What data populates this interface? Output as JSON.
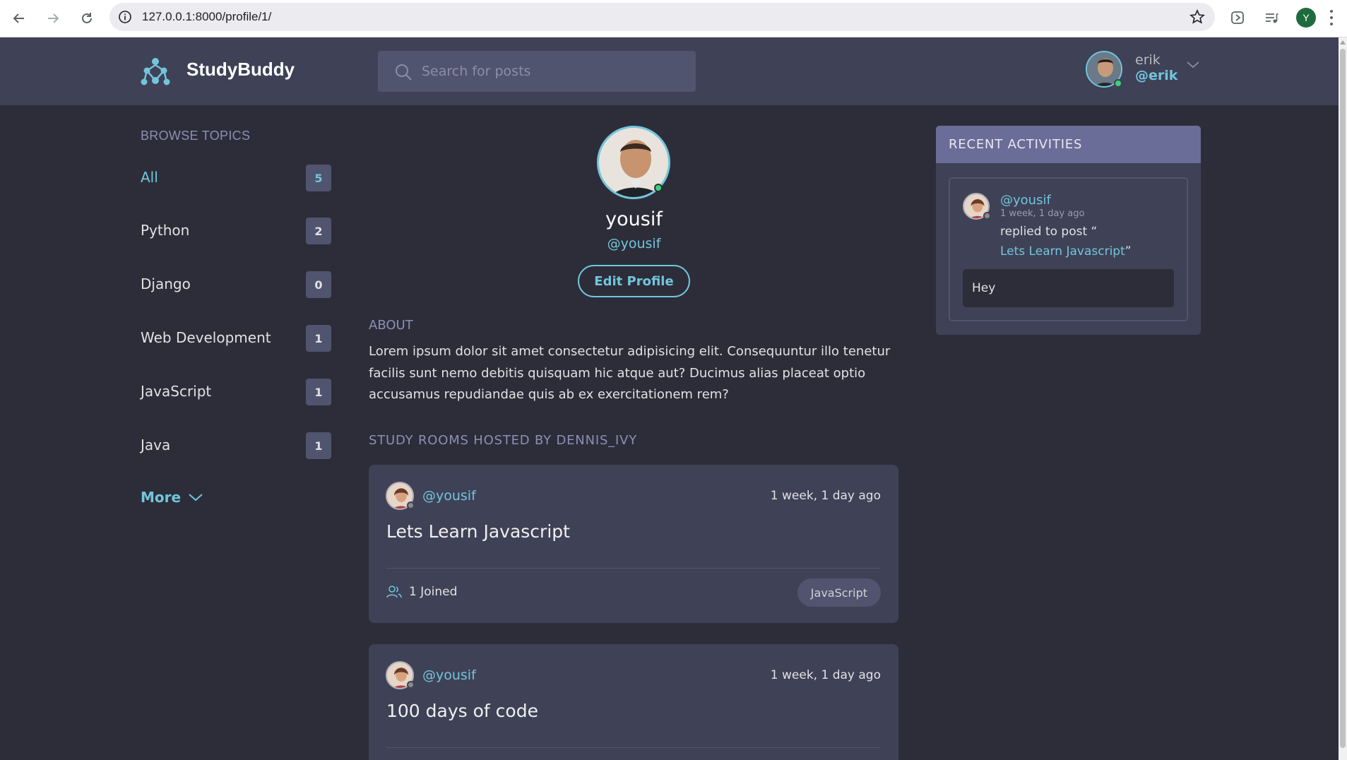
{
  "browser": {
    "url": "127.0.0.1:8000/profile/1/",
    "profile_initial": "Y"
  },
  "header": {
    "logo_text": "StudyBuddy",
    "search_placeholder": "Search for posts",
    "user": {
      "name": "erik",
      "handle": "@erik"
    }
  },
  "sidebar": {
    "title": "BROWSE TOPICS",
    "topics": [
      {
        "label": "All",
        "count": "5"
      },
      {
        "label": "Python",
        "count": "2"
      },
      {
        "label": "Django",
        "count": "0"
      },
      {
        "label": "Web Development",
        "count": "1"
      },
      {
        "label": "JavaScript",
        "count": "1"
      },
      {
        "label": "Java",
        "count": "1"
      }
    ],
    "more_label": "More"
  },
  "profile": {
    "name": "yousif",
    "handle": "@yousif",
    "edit_label": "Edit Profile",
    "about_title": "ABOUT",
    "about_text": "Lorem ipsum dolor sit amet consectetur adipisicing elit. Consequuntur illo tenetur facilis sunt nemo debitis quisquam hic atque aut? Ducimus alias placeat optio accusamus repudiandae quis ab ex exercitationem rem?",
    "rooms_title": "STUDY ROOMS HOSTED BY DENNIS_IVY"
  },
  "rooms": [
    {
      "user": "@yousif",
      "time": "1 week, 1 day ago",
      "title": "Lets Learn Javascript",
      "joined": "1 Joined",
      "tag": "JavaScript"
    },
    {
      "user": "@yousif",
      "time": "1 week, 1 day ago",
      "title": "100 days of code",
      "joined": "",
      "tag": ""
    }
  ],
  "activity": {
    "title": "RECENT ACTIVITIES",
    "items": [
      {
        "user": "@yousif",
        "time": "1 week, 1 day ago",
        "action": "replied to post “",
        "post": "Lets Learn Javascript",
        "post_close": "”",
        "body": "Hey"
      }
    ]
  },
  "colors": {
    "accent": "#71c6dd",
    "bg": "#2d2d39",
    "panel": "#3f4156",
    "online": "#3cd278"
  }
}
